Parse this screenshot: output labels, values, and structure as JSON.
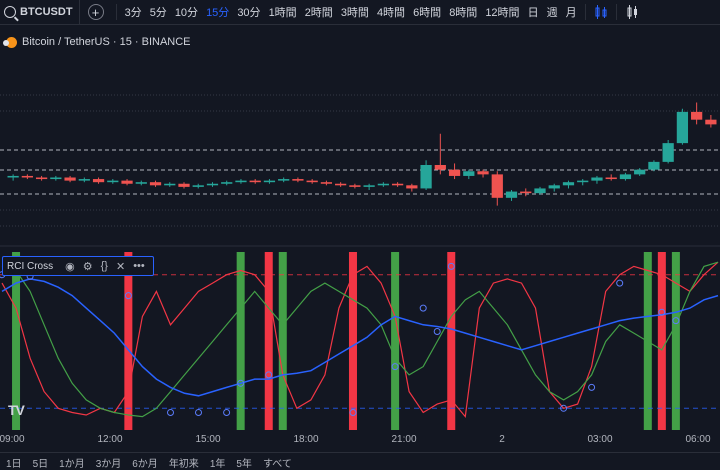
{
  "toolbar": {
    "symbol": "BTCUSDT",
    "add_symbol": "+",
    "intervals": [
      "3分",
      "5分",
      "10分",
      "15分",
      "30分",
      "1時間",
      "2時間",
      "3時間",
      "4時間",
      "6時間",
      "8時間",
      "12時間",
      "日",
      "週",
      "月"
    ],
    "active_interval": "15分"
  },
  "chart_info": {
    "title": "Bitcoin / TetherUS · 15 · BINANCE"
  },
  "indicator": {
    "name": "RCI Cross"
  },
  "x_axis": {
    "labels": [
      "09:00",
      "12:00",
      "15:00",
      "18:00",
      "21:00",
      "2",
      "03:00",
      "06:00"
    ]
  },
  "bottom_bar": {
    "ranges": [
      "1日",
      "5日",
      "1か月",
      "3か月",
      "6か月",
      "年初来",
      "1年",
      "5年",
      "すべて"
    ]
  },
  "colors": {
    "background": "#131722",
    "up": "#26a69a",
    "down": "#ef5350",
    "accent": "#2962ff",
    "rci_short": "#f23645",
    "rci_mid": "#43a047",
    "rci_long": "#2962ff",
    "signal_buy": "#43a047",
    "signal_sell": "#f23645"
  },
  "logo": "TV",
  "chart_data": {
    "type": "line",
    "series": [
      {
        "values": [
          70,
          40,
          -20,
          -60,
          -80,
          -85,
          -88,
          -80,
          -85,
          -60,
          30,
          60,
          20,
          40,
          60,
          70,
          80,
          85,
          80,
          60,
          -40,
          -80,
          -70,
          -40,
          40,
          80,
          90,
          70,
          30,
          -60,
          -85,
          -75,
          -70,
          -90,
          40,
          70,
          75,
          70,
          40,
          -60,
          -80,
          -75,
          -30,
          60,
          80,
          90,
          85,
          80,
          70,
          60,
          80,
          95
        ]
      },
      {
        "values": [
          90,
          85,
          60,
          20,
          -20,
          -50,
          -70,
          -80,
          -85,
          -88,
          -90,
          -80,
          -60,
          -40,
          -20,
          0,
          20,
          40,
          60,
          40,
          20,
          40,
          60,
          70,
          60,
          50,
          40,
          20,
          -20,
          -40,
          -30,
          0,
          30,
          50,
          60,
          40,
          20,
          -10,
          -40,
          -60,
          -70,
          -60,
          -40,
          0,
          20,
          10,
          0,
          -10,
          20,
          60,
          90,
          95
        ]
      },
      {
        "values": [
          60,
          70,
          75,
          72,
          65,
          55,
          40,
          25,
          10,
          -10,
          -30,
          -45,
          -55,
          -62,
          -65,
          -60,
          -55,
          -50,
          -45,
          -45,
          -40,
          -38,
          -35,
          -25,
          -15,
          -5,
          5,
          20,
          30,
          25,
          20,
          18,
          15,
          10,
          5,
          0,
          -5,
          -10,
          -5,
          0,
          5,
          10,
          15,
          20,
          25,
          28,
          30,
          32,
          35,
          40,
          50,
          55
        ]
      }
    ],
    "signals": [
      {
        "type": "buy",
        "x": 1
      },
      {
        "type": "sell",
        "x": 9
      },
      {
        "type": "buy",
        "x": 17
      },
      {
        "type": "sell",
        "x": 19
      },
      {
        "type": "buy",
        "x": 20
      },
      {
        "type": "sell",
        "x": 25
      },
      {
        "type": "buy",
        "x": 28
      },
      {
        "type": "sell",
        "x": 32
      },
      {
        "type": "buy",
        "x": 46
      },
      {
        "type": "sell",
        "x": 47
      },
      {
        "type": "buy",
        "x": 48
      }
    ],
    "ylim": [
      -100,
      100
    ],
    "price_candles": [
      [
        100.4,
        100.6,
        100.2,
        100.5
      ],
      [
        100.5,
        100.6,
        100.3,
        100.4
      ],
      [
        100.4,
        100.5,
        100.2,
        100.3
      ],
      [
        100.3,
        100.5,
        100.2,
        100.4
      ],
      [
        100.4,
        100.5,
        100.1,
        100.2
      ],
      [
        100.2,
        100.4,
        100.1,
        100.3
      ],
      [
        100.3,
        100.4,
        100.0,
        100.1
      ],
      [
        100.1,
        100.3,
        100.0,
        100.2
      ],
      [
        100.2,
        100.3,
        99.9,
        100.0
      ],
      [
        100.0,
        100.2,
        99.9,
        100.1
      ],
      [
        100.1,
        100.2,
        99.8,
        99.9
      ],
      [
        99.9,
        100.1,
        99.8,
        100.0
      ],
      [
        100.0,
        100.1,
        99.7,
        99.8
      ],
      [
        99.8,
        100.0,
        99.7,
        99.9
      ],
      [
        99.9,
        100.1,
        99.8,
        100.0
      ],
      [
        100.0,
        100.2,
        99.9,
        100.1
      ],
      [
        100.1,
        100.3,
        100.0,
        100.2
      ],
      [
        100.2,
        100.3,
        100.0,
        100.1
      ],
      [
        100.1,
        100.3,
        100.0,
        100.2
      ],
      [
        100.2,
        100.4,
        100.1,
        100.3
      ],
      [
        100.3,
        100.4,
        100.1,
        100.2
      ],
      [
        100.2,
        100.3,
        100.0,
        100.1
      ],
      [
        100.1,
        100.2,
        99.9,
        100.0
      ],
      [
        100.0,
        100.1,
        99.8,
        99.9
      ],
      [
        99.9,
        100.0,
        99.7,
        99.8
      ],
      [
        99.8,
        100.0,
        99.6,
        99.9
      ],
      [
        99.9,
        100.1,
        99.8,
        100.0
      ],
      [
        100.0,
        100.1,
        99.8,
        99.9
      ],
      [
        99.9,
        100.0,
        99.5,
        99.7
      ],
      [
        99.7,
        101.5,
        99.6,
        101.2
      ],
      [
        101.2,
        103.2,
        100.6,
        100.9
      ],
      [
        100.9,
        101.3,
        100.3,
        100.5
      ],
      [
        100.5,
        100.9,
        100.3,
        100.8
      ],
      [
        100.8,
        100.9,
        100.4,
        100.6
      ],
      [
        100.6,
        100.8,
        98.6,
        99.1
      ],
      [
        99.1,
        99.6,
        98.9,
        99.5
      ],
      [
        99.5,
        99.7,
        99.2,
        99.4
      ],
      [
        99.4,
        99.8,
        99.3,
        99.7
      ],
      [
        99.7,
        100.0,
        99.5,
        99.9
      ],
      [
        99.9,
        100.2,
        99.7,
        100.1
      ],
      [
        100.1,
        100.3,
        99.9,
        100.2
      ],
      [
        100.2,
        100.5,
        100.0,
        100.4
      ],
      [
        100.4,
        100.6,
        100.2,
        100.3
      ],
      [
        100.3,
        100.7,
        100.2,
        100.6
      ],
      [
        100.6,
        101.0,
        100.5,
        100.9
      ],
      [
        100.9,
        101.5,
        100.8,
        101.4
      ],
      [
        101.4,
        102.8,
        101.3,
        102.6
      ],
      [
        102.6,
        104.8,
        102.5,
        104.6
      ],
      [
        104.6,
        105.2,
        103.8,
        104.1
      ],
      [
        104.1,
        104.4,
        103.6,
        103.8
      ]
    ]
  }
}
